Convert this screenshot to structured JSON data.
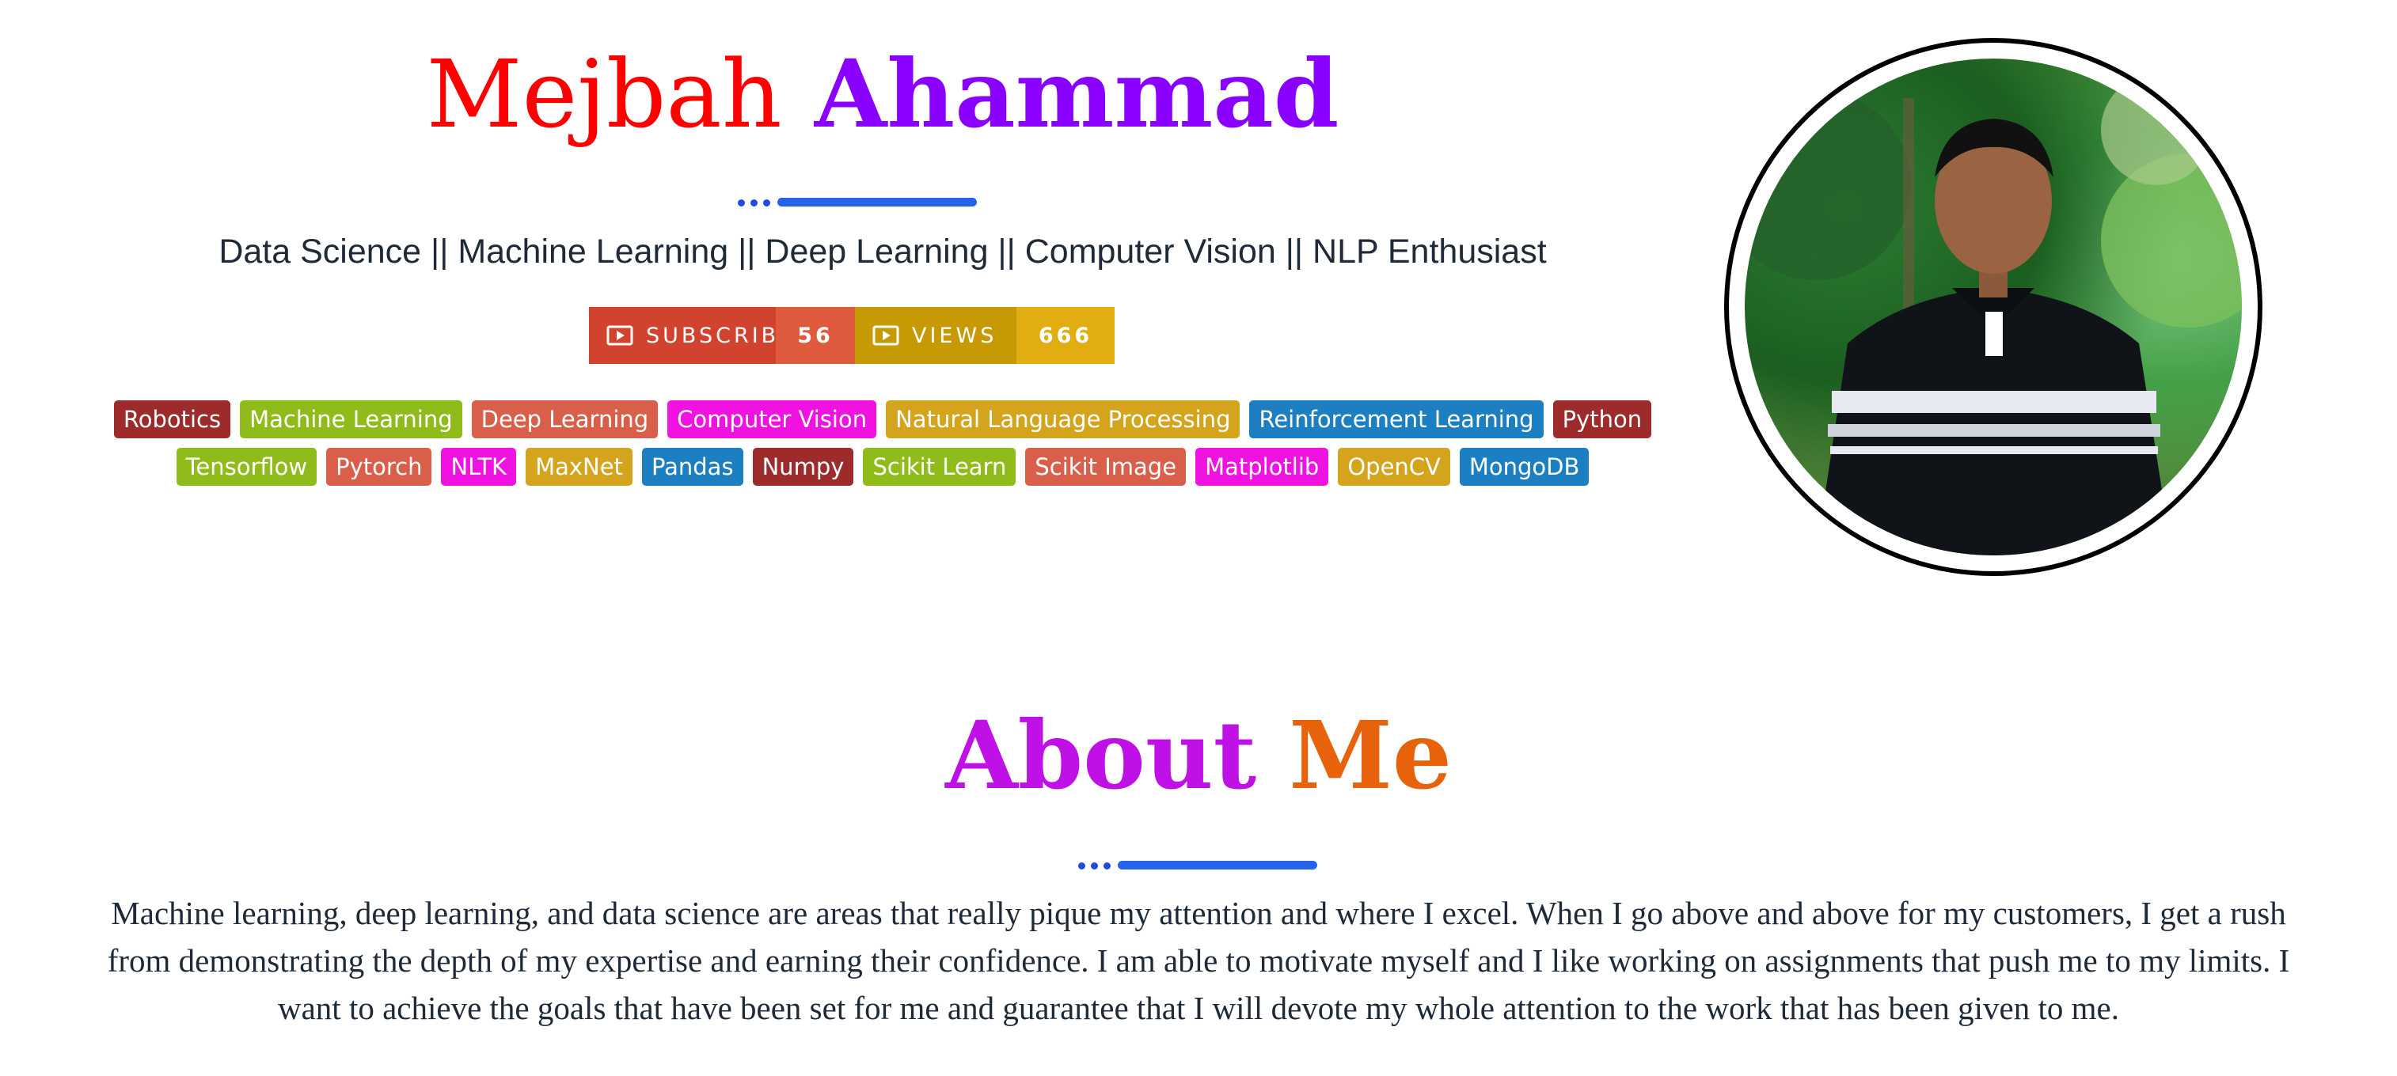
{
  "header": {
    "first_name": "Mejbah",
    "last_name": "Ahammad",
    "tagline": "Data Science || Machine Learning || Deep Learning || Computer Vision || NLP Enthusiast"
  },
  "badges": {
    "subscribe": {
      "label": "SUBSCRIBE",
      "count": "56",
      "icon": "play-icon"
    },
    "views": {
      "label": "VIEWS",
      "count": "666",
      "icon": "play-icon"
    }
  },
  "tags": [
    {
      "label": "Robotics",
      "color": "#9e2b2b"
    },
    {
      "label": "Machine Learning",
      "color": "#8fbc1a"
    },
    {
      "label": "Deep Learning",
      "color": "#d95f4a"
    },
    {
      "label": "Computer Vision",
      "color": "#f012e0"
    },
    {
      "label": "Natural Language Processing",
      "color": "#d4a41c"
    },
    {
      "label": "Reinforcement Learning",
      "color": "#1c7fc2"
    },
    {
      "label": "Python",
      "color": "#9e2b2b"
    },
    {
      "label": "Tensorflow",
      "color": "#8fbc1a"
    },
    {
      "label": "Pytorch",
      "color": "#d95f4a"
    },
    {
      "label": "NLTK",
      "color": "#f012e0"
    },
    {
      "label": "MaxNet",
      "color": "#d4a41c"
    },
    {
      "label": "Pandas",
      "color": "#1c7fc2"
    },
    {
      "label": "Numpy",
      "color": "#9e2b2b"
    },
    {
      "label": "Scikit Learn",
      "color": "#8fbc1a"
    },
    {
      "label": "Scikit Image",
      "color": "#d95f4a"
    },
    {
      "label": "Matplotlib",
      "color": "#f012e0"
    },
    {
      "label": "OpenCV",
      "color": "#d4a41c"
    },
    {
      "label": "MongoDB",
      "color": "#1c7fc2"
    }
  ],
  "about": {
    "title_first": "About",
    "title_second": "Me",
    "text": "Machine learning, deep learning, and data science are areas that really pique my attention and where I excel. When I go above and above for my customers, I get a rush from demonstrating the depth of my expertise and earning their confidence. I am able to motivate myself and I like working on assignments that push me to my limits. I want to achieve the goals that have been set for me and guarantee that I will devote my whole attention to the work that has been given to me."
  },
  "colors": {
    "first_name": "#ff0000",
    "last_name": "#8a00ff",
    "about_first": "#bf10e6",
    "about_second": "#e8620c",
    "divider": "#2563eb"
  }
}
